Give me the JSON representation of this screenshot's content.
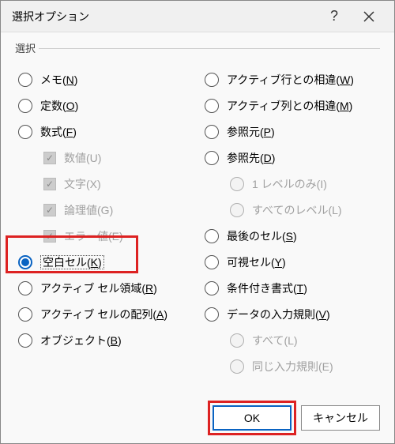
{
  "title": "選択オプション",
  "group_label": "選択",
  "left": {
    "memo": {
      "text": "メモ(",
      "key": "N",
      "suffix": ")"
    },
    "const": {
      "text": "定数(",
      "key": "O",
      "suffix": ")"
    },
    "formula": {
      "text": "数式(",
      "key": "F",
      "suffix": ")"
    },
    "num": {
      "text": "数値(",
      "key": "U",
      "suffix": ")"
    },
    "str": {
      "text": "文字(",
      "key": "X",
      "suffix": ")"
    },
    "logic": {
      "text": "論理値(",
      "key": "G",
      "suffix": ")"
    },
    "err": {
      "text": "エラー値(",
      "key": "E",
      "suffix": ")"
    },
    "blank": {
      "text": "空白セル(",
      "key": "K",
      "suffix": ")"
    },
    "region": {
      "text": "アクティブ セル領域(",
      "key": "R",
      "suffix": ")"
    },
    "array": {
      "text": "アクティブ セルの配列(",
      "key": "A",
      "suffix": ")"
    },
    "object": {
      "text": "オブジェクト(",
      "key": "B",
      "suffix": ")"
    }
  },
  "right": {
    "rowdiff": {
      "text": "アクティブ行との相違(",
      "key": "W",
      "suffix": ")"
    },
    "coldiff": {
      "text": "アクティブ列との相違(",
      "key": "M",
      "suffix": ")"
    },
    "prec": {
      "text": "参照元(",
      "key": "P",
      "suffix": ")"
    },
    "dep": {
      "text": "参照先(",
      "key": "D",
      "suffix": ")"
    },
    "lvl1": {
      "text": "1 レベルのみ(",
      "key": "I",
      "suffix": ")"
    },
    "lvlall": {
      "text": "すべてのレベル(",
      "key": "L",
      "suffix": ")"
    },
    "last": {
      "text": "最後のセル(",
      "key": "S",
      "suffix": ")"
    },
    "visible": {
      "text": "可視セル(",
      "key": "Y",
      "suffix": ")"
    },
    "condfmt": {
      "text": "条件付き書式(",
      "key": "T",
      "suffix": ")"
    },
    "valid": {
      "text": "データの入力規則(",
      "key": "V",
      "suffix": ")"
    },
    "all": {
      "text": "すべて(",
      "key": "L",
      "suffix": ")"
    },
    "same": {
      "text": "同じ入力規則(",
      "key": "E",
      "suffix": ")"
    }
  },
  "buttons": {
    "ok": "OK",
    "cancel": "キャンセル"
  }
}
